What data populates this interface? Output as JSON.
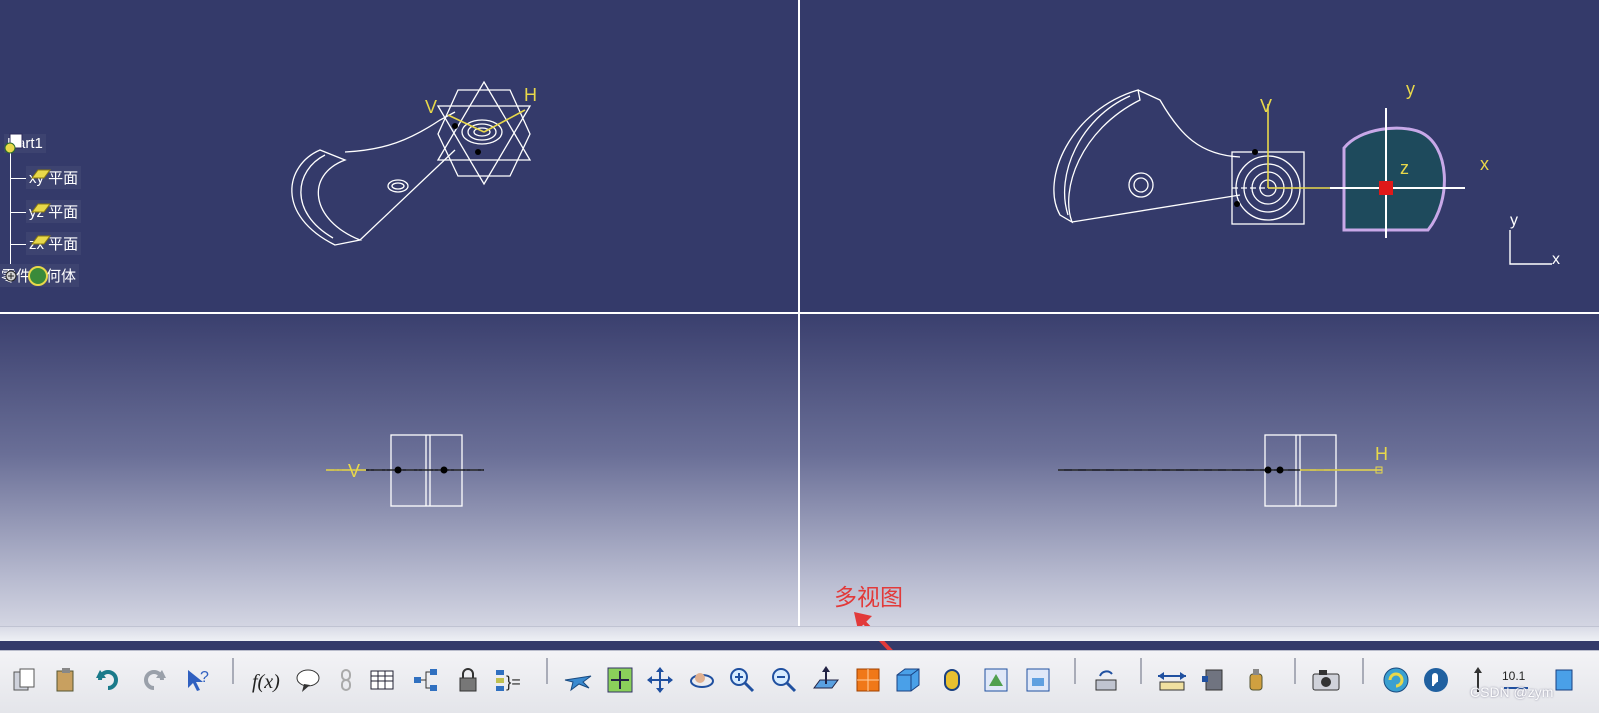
{
  "tree": {
    "root": "Part1",
    "items": [
      "xy 平面",
      "yz 平面",
      "zx 平面",
      "零件几何体"
    ]
  },
  "axis_labels": {
    "tl_v": "V",
    "tl_h": "H",
    "tr_v": "V",
    "tr_y": "y",
    "tr_x": "x",
    "tr_z": "z",
    "compass_y": "y",
    "compass_x": "x",
    "bl_v": "V",
    "br_h": "H"
  },
  "annotation": {
    "label": "多视图",
    "color": "#e23a3a"
  },
  "watermark": "CSDN @zym",
  "colors": {
    "background": "#343a6a",
    "axis": "#e8d84a",
    "sketch": "#ffffff",
    "compass_fill": "#1e4a5c",
    "compass_stroke": "#c8a8e8",
    "accent_red": "#e01818"
  },
  "toolbar": {
    "buttons": [
      "paste-special-icon",
      "paste-icon",
      "undo-icon",
      "redo-icon",
      "whats-this-icon",
      "formula-icon",
      "comment-icon",
      "link-icon",
      "table-icon",
      "tree-graph-icon",
      "lock-icon",
      "parameters-icon",
      "fly-mode-icon",
      "fit-all-icon",
      "pan-icon",
      "rotate-icon",
      "zoom-in-icon",
      "zoom-out-icon",
      "normal-view-icon",
      "multi-view-icon",
      "iso-view-icon",
      "shading-icon",
      "hide-show-icon",
      "swap-space-icon",
      "measure-between-icon",
      "measure-item-icon",
      "measure-inertia-icon",
      "capture-icon",
      "knowledge-icon",
      "manipulation-icon",
      "scale-icon"
    ]
  }
}
